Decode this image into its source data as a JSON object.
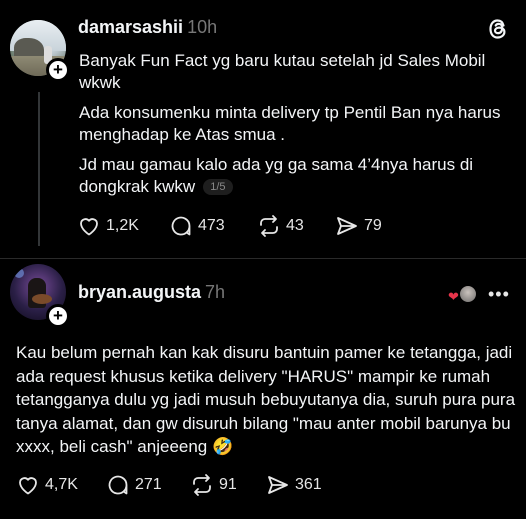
{
  "post1": {
    "username": "damarsashii",
    "time": "10h",
    "paragraphs": [
      "Banyak Fun Fact yg baru kutau setelah jd Sales Mobil wkwk",
      "Ada konsumenku minta delivery tp Pentil Ban nya harus menghadap ke Atas smua .",
      "Jd mau gamau kalo ada yg ga sama 4’4nya harus di dongkrak kwkw"
    ],
    "pager": "1/5",
    "stats": {
      "likes": "1,2K",
      "replies": "473",
      "reposts": "43",
      "shares": "79"
    }
  },
  "post2": {
    "username": "bryan.augusta",
    "time": "7h",
    "text": "Kau belum pernah kan kak disuru bantuin pamer ke tetangga, jadi ada request khusus ketika delivery \"HARUS\" mampir ke rumah tetangganya dulu yg jadi musuh bebuyutanya dia, suruh pura pura tanya alamat, dan gw disuruh bilang \"mau anter mobil barunya bu xxxx, beli cash\" anjeeeng 🤣",
    "stats": {
      "likes": "4,7K",
      "replies": "271",
      "reposts": "91",
      "shares": "361"
    }
  },
  "icons": {
    "follow": "+",
    "more": "•••",
    "heart_small": "❤"
  },
  "colors": {
    "background": "#000000",
    "text": "#f3f5f7",
    "muted": "#777777",
    "like_heart": "#e5344a"
  }
}
